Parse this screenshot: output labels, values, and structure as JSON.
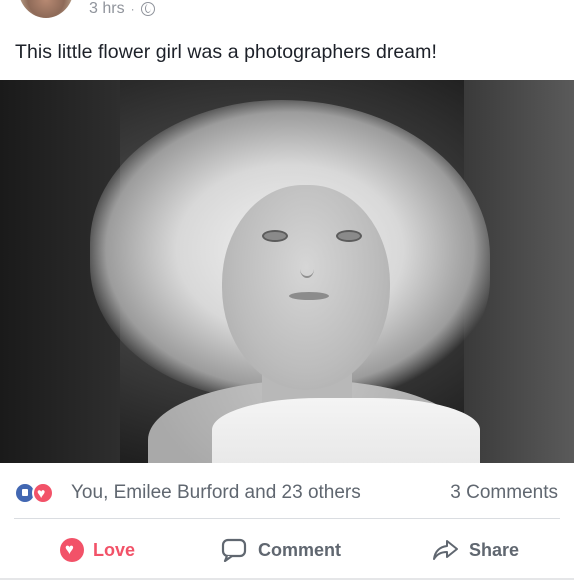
{
  "post": {
    "time": "3 hrs",
    "separator": "·",
    "caption": "This little flower girl was a photographers dream!"
  },
  "reactions": {
    "summary": "You, Emilee Burford and 23 others",
    "comments": "3 Comments",
    "icons": [
      "like-icon",
      "love-icon"
    ]
  },
  "actions": {
    "love": "Love",
    "comment": "Comment",
    "share": "Share"
  },
  "colors": {
    "love": "#f25268",
    "like": "#4267b2",
    "secondary_text": "#606770",
    "meta_text": "#90949c"
  }
}
